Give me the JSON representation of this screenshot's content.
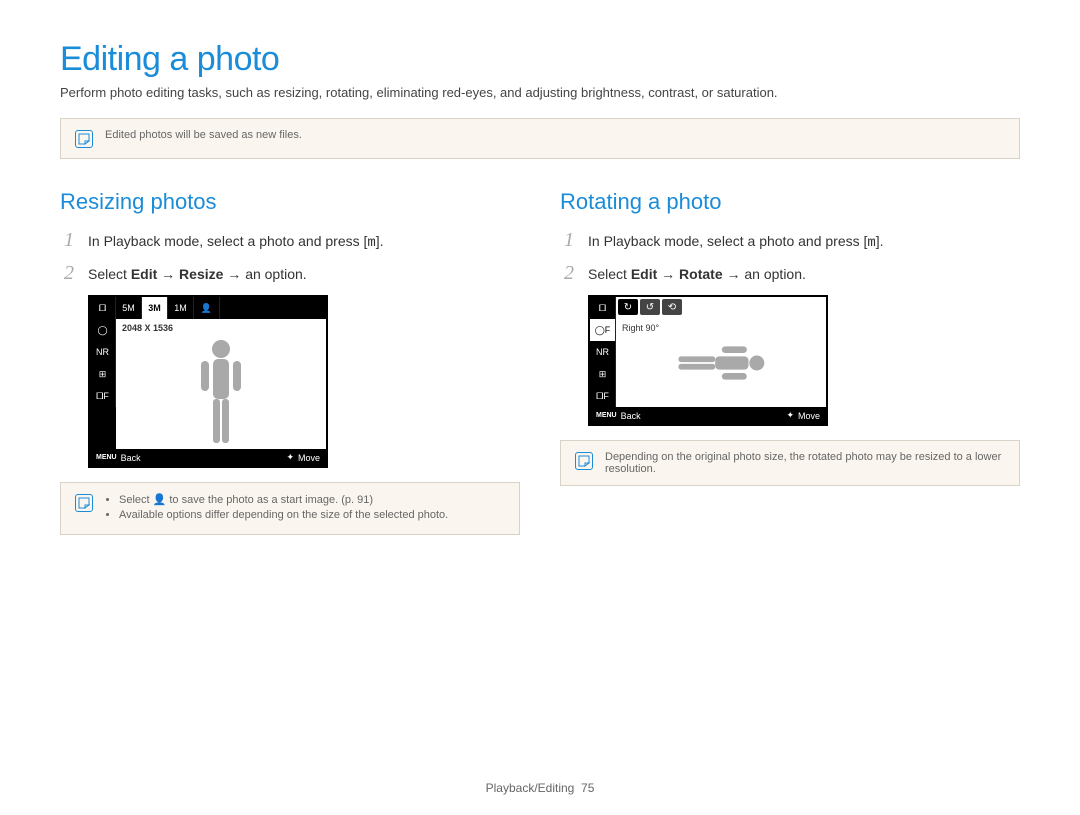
{
  "page_title": "Editing a photo",
  "intro": "Perform photo editing tasks, such as resizing, rotating, eliminating red-eyes, and adjusting brightness, contrast, or saturation.",
  "top_note": "Edited photos will be saved as new files.",
  "left": {
    "heading": "Resizing photos",
    "step1_num": "1",
    "step1_text_a": "In Playback mode, select a photo and press [",
    "step1_text_b": "m",
    "step1_text_c": "].",
    "step2_num": "2",
    "step2_text_a": "Select ",
    "step2_text_b": "Edit",
    "step2_arrow1": " → ",
    "step2_text_c": "Resize",
    "step2_arrow2": " → ",
    "step2_text_d": "an option.",
    "lcd": {
      "top_icons": [
        "🞑",
        "5M",
        "3M",
        "1M",
        "👤"
      ],
      "top_active_index": 2,
      "side_icons": [
        "◯",
        "NR",
        "⊞",
        "🞑F"
      ],
      "resolution_label": "2048 X 1536",
      "bottom_left": "Back",
      "bottom_left_label": "MENU",
      "bottom_right": "Move"
    },
    "note_bullets": [
      "Select 👤 to save the photo as a start image. (p. 91)",
      "Available options differ depending on the size of the selected photo."
    ]
  },
  "right": {
    "heading": "Rotating a photo",
    "step1_num": "1",
    "step1_text_a": "In Playback mode, select a photo and press [",
    "step1_text_b": "m",
    "step1_text_c": "].",
    "step2_num": "2",
    "step2_text_a": "Select ",
    "step2_text_b": "Edit",
    "step2_arrow1": " → ",
    "step2_text_c": "Rotate",
    "step2_arrow2": " → ",
    "step2_text_d": "an option.",
    "lcd": {
      "side_icons_top": [
        "🞑"
      ],
      "rot_icons": [
        "↻",
        "↺",
        "⟲"
      ],
      "rot_active_index_is_none": true,
      "side_icons": [
        "◯F",
        "NR",
        "⊞",
        "🞑F"
      ],
      "rotate_label": "Right 90°",
      "bottom_left": "Back",
      "bottom_left_label": "MENU",
      "bottom_right": "Move"
    },
    "note_text": "Depending on the original photo size, the rotated photo may be resized to a lower resolution."
  },
  "footer_section": "Playback/Editing",
  "footer_page": "75"
}
